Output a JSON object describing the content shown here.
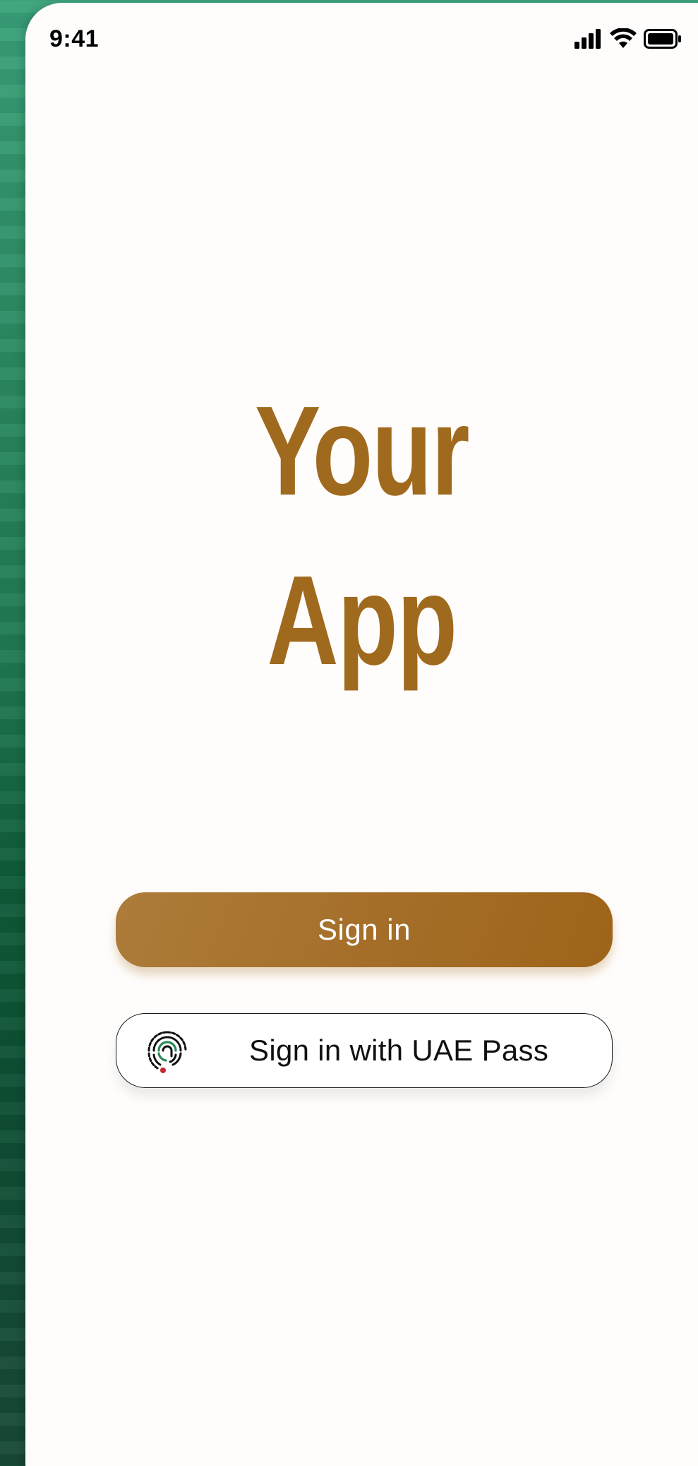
{
  "status_bar": {
    "time": "9:41",
    "icons": [
      "signal-icon",
      "wifi-icon",
      "battery-icon"
    ]
  },
  "hero": {
    "line1": "Your",
    "line2": "App"
  },
  "actions": {
    "sign_in_label": "Sign in",
    "uae_pass_label": "Sign in with UAE Pass",
    "uae_pass_icon": "fingerprint-icon"
  },
  "colors": {
    "brand_gold": "#a06a1e",
    "background_green": "#1f7a52",
    "surface": "#fffdfc"
  }
}
